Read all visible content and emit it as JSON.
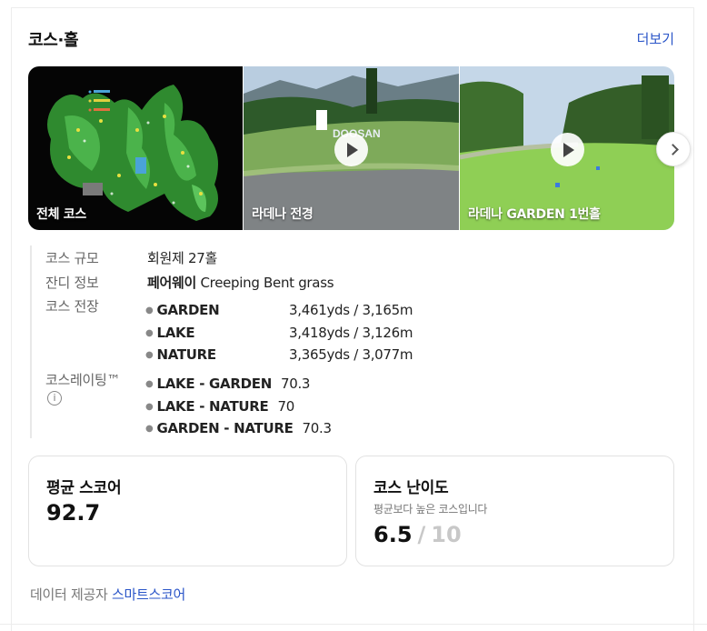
{
  "header": {
    "title": "코스·홀",
    "more_label": "더보기"
  },
  "gallery": {
    "tiles": [
      {
        "caption": "전체 코스"
      },
      {
        "caption": "라데나 전경"
      },
      {
        "caption": "라데나 GARDEN 1번홀"
      }
    ]
  },
  "info": {
    "size": {
      "label": "코스 규모",
      "value": "회원제 27홀"
    },
    "grass": {
      "label": "잔디 정보",
      "value_bold": "페어웨이",
      "value_rest": "Creeping Bent grass"
    },
    "length": {
      "label": "코스 전장",
      "rows": [
        {
          "name": "GARDEN",
          "value": "3,461yds / 3,165m"
        },
        {
          "name": "LAKE",
          "value": "3,418yds / 3,126m"
        },
        {
          "name": "NATURE",
          "value": "3,365yds / 3,077m"
        }
      ]
    },
    "rating": {
      "label": "코스레이팅™",
      "info_icon": "info-circle-icon",
      "rows": [
        {
          "name": "LAKE - GARDEN",
          "value": "70.3"
        },
        {
          "name": "LAKE - NATURE",
          "value": "70"
        },
        {
          "name": "GARDEN - NATURE",
          "value": "70.3"
        }
      ]
    }
  },
  "avg_score": {
    "title": "평균 스코어",
    "value": "92.7"
  },
  "difficulty": {
    "title": "코스 난이도",
    "subtitle": "평균보다 높은 코스입니다",
    "value": "6.5",
    "separator": "/",
    "max": "10"
  },
  "footer": {
    "label": "데이터 제공자",
    "provider": "스마트스코어"
  },
  "colors": {
    "accent": "#2a55c8",
    "muted": "#c8c8c8"
  }
}
